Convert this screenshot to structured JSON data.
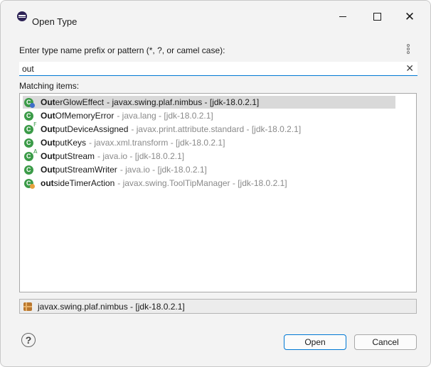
{
  "window": {
    "title": "Open Type",
    "controls": {
      "minimize": "minimize",
      "maximize": "maximize",
      "close": "close"
    }
  },
  "dialog": {
    "prompt": "Enter type name prefix or pattern (*, ?, or camel case):",
    "search": {
      "value": "out"
    },
    "matching_label": "Matching items:",
    "items": [
      {
        "match": "Out",
        "rest": "erGlowEffect",
        "qualifier": "- javax.swing.plaf.nimbus - [jdk-18.0.2.1]",
        "selected": true,
        "overlay": "blue-dot"
      },
      {
        "match": "Out",
        "rest": "OfMemoryError",
        "qualifier": "- java.lang - [jdk-18.0.2.1]",
        "selected": false,
        "overlay": ""
      },
      {
        "match": "Out",
        "rest": "putDeviceAssigned",
        "qualifier": "- javax.print.attribute.standard - [jdk-18.0.2.1]",
        "selected": false,
        "overlay": "F"
      },
      {
        "match": "Out",
        "rest": "putKeys",
        "qualifier": "- javax.xml.transform - [jdk-18.0.2.1]",
        "selected": false,
        "overlay": ""
      },
      {
        "match": "Out",
        "rest": "putStream",
        "qualifier": "- java.io - [jdk-18.0.2.1]",
        "selected": false,
        "overlay": "A"
      },
      {
        "match": "Out",
        "rest": "putStreamWriter",
        "qualifier": "- java.io - [jdk-18.0.2.1]",
        "selected": false,
        "overlay": ""
      },
      {
        "match": "out",
        "rest": "sideTimerAction",
        "qualifier": "- javax.swing.ToolTipManager - [jdk-18.0.2.1]",
        "selected": false,
        "overlay": "orange-dot"
      }
    ],
    "status_text": "javax.swing.plaf.nimbus - [jdk-18.0.2.1]",
    "help_label": "?",
    "buttons": {
      "open": "Open",
      "cancel": "Cancel"
    }
  },
  "colors": {
    "accent": "#0078d4",
    "selection": "#d9d9d9",
    "class_icon": "#3b9b48"
  }
}
